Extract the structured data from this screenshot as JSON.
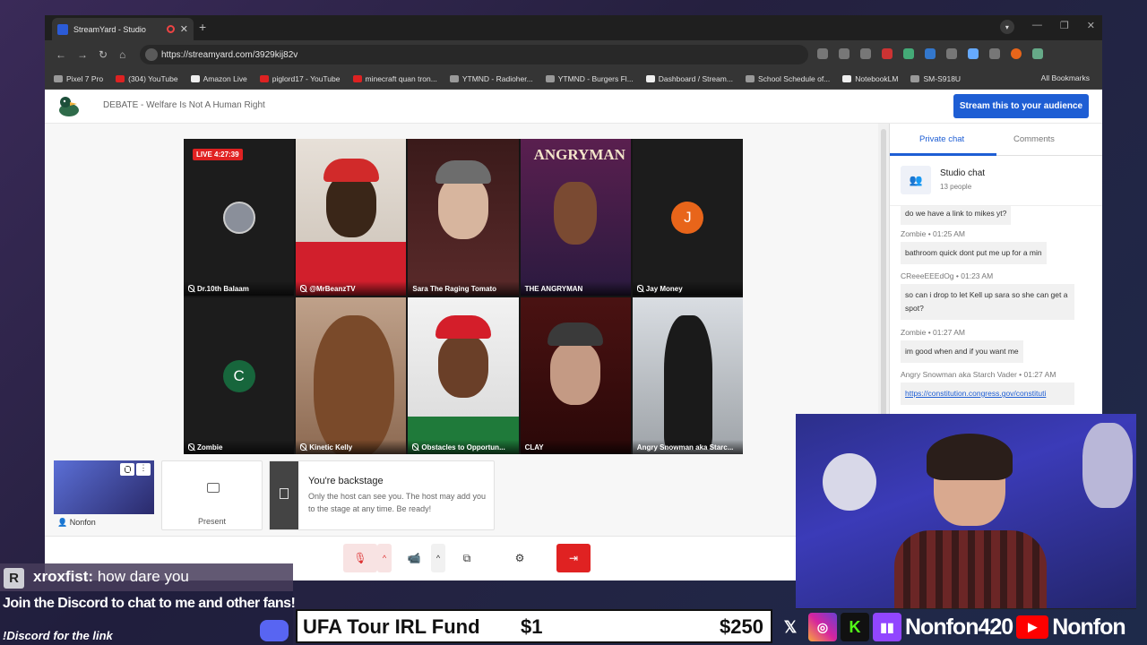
{
  "browser": {
    "tab_title": "StreamYard - Studio",
    "url": "https://streamyard.com/3929kij82v",
    "bookmarks": [
      "Pixel 7 Pro",
      "(304) YouTube",
      "Amazon Live",
      "piglord17 - YouTube",
      "minecraft quan tron...",
      "YTMND - Radioher...",
      "YTMND - Burgers Fl...",
      "Dashboard / Stream...",
      "School Schedule of...",
      "NotebookLM",
      "SM-S918U"
    ],
    "all_bookmarks": "All Bookmarks"
  },
  "studio": {
    "broadcast_title": "DEBATE - Welfare Is Not A Human Right",
    "stream_button": "Stream this to your audience",
    "live_badge": "LIVE 4:27:39",
    "participants": [
      {
        "name": "Dr.10th Balaam",
        "muted": true
      },
      {
        "name": "@MrBeanzTV",
        "muted": true
      },
      {
        "name": "Sara The Raging Tomato",
        "muted": false
      },
      {
        "name": "THE ANGRYMAN",
        "muted": false
      },
      {
        "name": "Jay Money",
        "muted": true,
        "initial": "J",
        "avatar_color": "#e8651a"
      },
      {
        "name": "Zombie",
        "muted": true,
        "initial": "C",
        "avatar_color": "#17663c"
      },
      {
        "name": "Kinetic Kelly",
        "muted": true
      },
      {
        "name": "Obstacles to Opportun...",
        "muted": true
      },
      {
        "name": "CLAY",
        "muted": false
      },
      {
        "name": "Angry Snowman aka Starc...",
        "muted": false
      }
    ],
    "self_name": "Nonfon",
    "present_label": "Present",
    "backstage_title": "You're backstage",
    "backstage_desc": "Only the host can see you. The host may add you to the stage at any time. Be ready!"
  },
  "chat": {
    "tab_private": "Private chat",
    "tab_comments": "Comments",
    "room_title": "Studio chat",
    "room_count": "13 people",
    "messages": [
      {
        "text": "do we have a link to mikes yt?"
      },
      {
        "author": "Zombie",
        "time": "01:25 AM",
        "text": "bathroom quick dont put me up for a min"
      },
      {
        "author": "CReeeEEEdOg",
        "time": "01:23 AM",
        "text": "so can i drop to let Kell up sara so she can get a spot?"
      },
      {
        "author": "Zombie",
        "time": "01:27 AM",
        "text": "im good when and if you want me"
      },
      {
        "author": "Angry Snowman aka Starch Vader",
        "time": "01:27 AM",
        "text": "https://constitution.congress.gov/constituti"
      }
    ]
  },
  "overlay": {
    "chat_initial": "R",
    "chat_user": "xroxfist:",
    "chat_text": "how dare you",
    "discord_line1": "Join the Discord to chat to me and other fans!",
    "discord_line2": "!Discord for the link",
    "fund_name": "UFA Tour IRL Fund",
    "fund_current": "$1",
    "fund_goal": "$250",
    "twitch_handle": "Nonfon420",
    "youtube_handle": "Nonfon"
  }
}
